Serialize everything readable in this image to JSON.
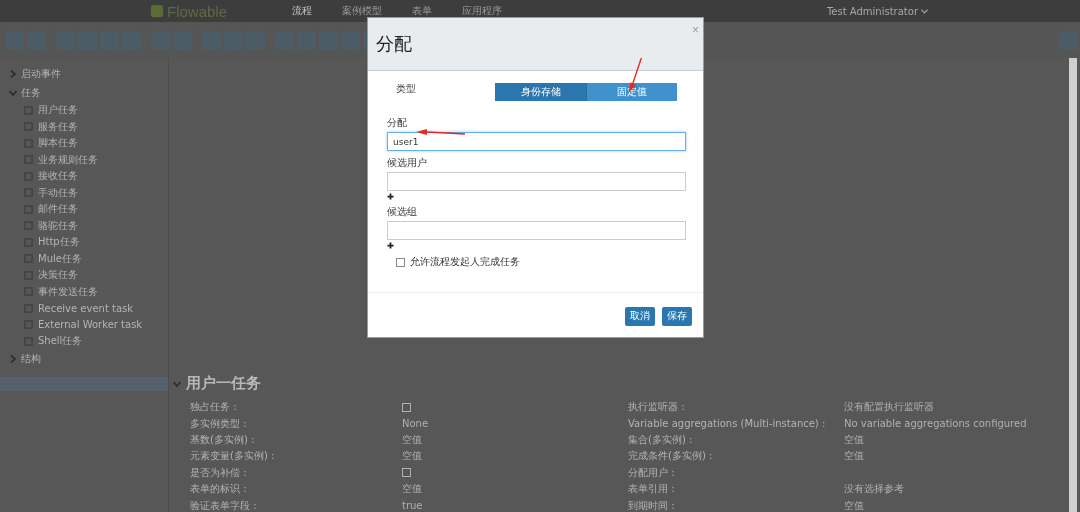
{
  "navbar": {
    "logo": "Flowable",
    "menu": [
      {
        "label": "流程",
        "selected": true
      },
      {
        "label": "案例模型",
        "selected": false
      },
      {
        "label": "表单",
        "selected": false
      },
      {
        "label": "应用程序",
        "selected": false
      }
    ],
    "user": "Test Administrator"
  },
  "palette": [
    {
      "label": "启动事件",
      "expanded": false
    },
    {
      "label": "任务",
      "expanded": true,
      "children": [
        "用户任务",
        "服务任务",
        "脚本任务",
        "业务规则任务",
        "接收任务",
        "手动任务",
        "邮件任务",
        "骆驼任务",
        "Http任务",
        "Mule任务",
        "决策任务",
        "事件发送任务",
        "Receive event task",
        "External Worker task",
        "Shell任务"
      ]
    },
    {
      "label": "结构",
      "expanded": false
    }
  ],
  "properties": {
    "title": "用户一任务",
    "expanded": true,
    "left": [
      {
        "label": "独占任务 :",
        "kind": "checkbox",
        "checked": false
      },
      {
        "label": "多实例类型 :",
        "kind": "text",
        "value": "None"
      },
      {
        "label": "基数(多实例) :",
        "kind": "text",
        "value": "空值"
      },
      {
        "label": "元素变量(多实例) :",
        "kind": "text",
        "value": "空值"
      },
      {
        "label": "是否为补偿 :",
        "kind": "checkbox",
        "checked": false
      },
      {
        "label": "表单的标识 :",
        "kind": "text",
        "value": "空值"
      },
      {
        "label": "验证表单字段 :",
        "kind": "text",
        "value": "true"
      }
    ],
    "right": [
      {
        "label": "执行监听器 :",
        "kind": "text",
        "value": "没有配置执行监听器"
      },
      {
        "label": "Variable aggregations (Multi-instance) :",
        "kind": "text",
        "value": "No variable aggregations configured"
      },
      {
        "label": "集合(多实例) :",
        "kind": "text",
        "value": "空值"
      },
      {
        "label": "完成条件(多实例) :",
        "kind": "text",
        "value": "空值"
      },
      {
        "label": "分配用户 :",
        "kind": "text"
      },
      {
        "label": "表单引用 :",
        "kind": "text",
        "value": "没有选择参考"
      },
      {
        "label": "到期时间 :",
        "kind": "text",
        "value": "空值"
      }
    ]
  },
  "dialog": {
    "title": "分配",
    "close": "×",
    "type_label": "类型",
    "type_options": [
      {
        "label": "身份存储",
        "selected": true
      },
      {
        "label": "固定值",
        "selected": false
      }
    ],
    "fields": [
      {
        "label": "分配",
        "value": "user1",
        "focused": true,
        "addable": false
      },
      {
        "label": "候选用户",
        "focused": false,
        "addable": true
      },
      {
        "label": "候选组",
        "focused": false,
        "addable": true
      }
    ],
    "checkbox": {
      "label": "允许流程发起人完成任务",
      "checked": false
    },
    "buttons": [
      "取消",
      "保存"
    ]
  }
}
